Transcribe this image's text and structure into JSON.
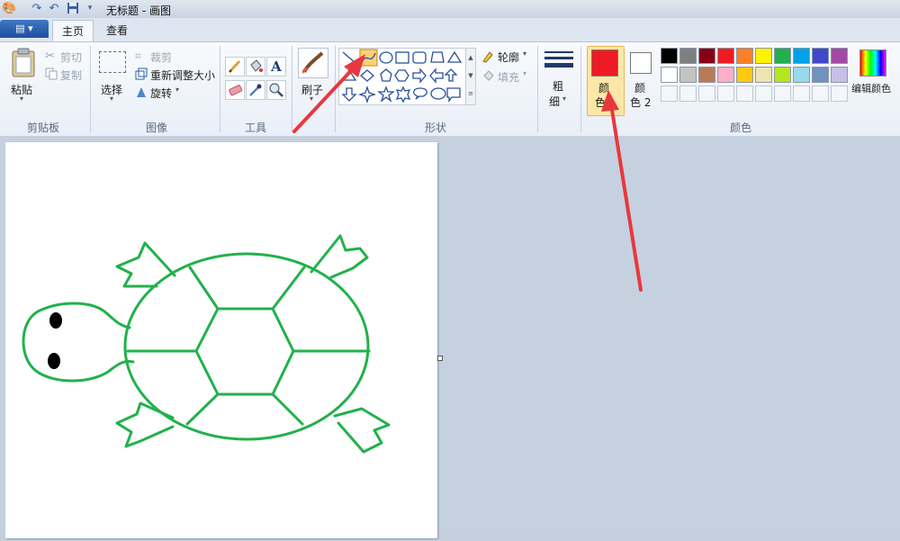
{
  "window": {
    "title": "无标题 - 画图"
  },
  "tabs": {
    "home": "主页",
    "view": "查看"
  },
  "clipboard": {
    "paste": "粘贴",
    "cut": "剪切",
    "copy": "复制",
    "group": "剪贴板"
  },
  "image": {
    "select": "选择",
    "crop": "裁剪",
    "resize": "重新调整大小",
    "rotate": "旋转",
    "group": "图像"
  },
  "tools": {
    "group": "工具"
  },
  "brushes": {
    "label": "刷子"
  },
  "shapes": {
    "outline": "轮廓",
    "fill": "填充",
    "group": "形状"
  },
  "size": {
    "label_line1": "粗",
    "label_line2": "细"
  },
  "colors": {
    "color1_line1": "颜",
    "color1_line2": "色",
    "color2_line1": "颜",
    "color2_line2": "色 2",
    "edit_colors": "编辑颜色",
    "group": "颜色",
    "color1_value": "#ed1c24",
    "color2_value": "#ffffff",
    "palette_row1": [
      "#000000",
      "#7f7f7f",
      "#880015",
      "#ed1c24",
      "#ff7f27",
      "#fff200",
      "#22b14c",
      "#00a2e8",
      "#3f48cc",
      "#a349a4"
    ],
    "palette_row2": [
      "#ffffff",
      "#c3c3c3",
      "#b97a57",
      "#ffaec9",
      "#ffc90e",
      "#efe4b0",
      "#b5e61d",
      "#99d9ea",
      "#7092be",
      "#c8bfe7"
    ]
  },
  "drawing": {
    "stroke_color": "#22b14c",
    "eye_color": "#000000"
  },
  "annotation": {
    "arrow_color": "#e8383d"
  }
}
